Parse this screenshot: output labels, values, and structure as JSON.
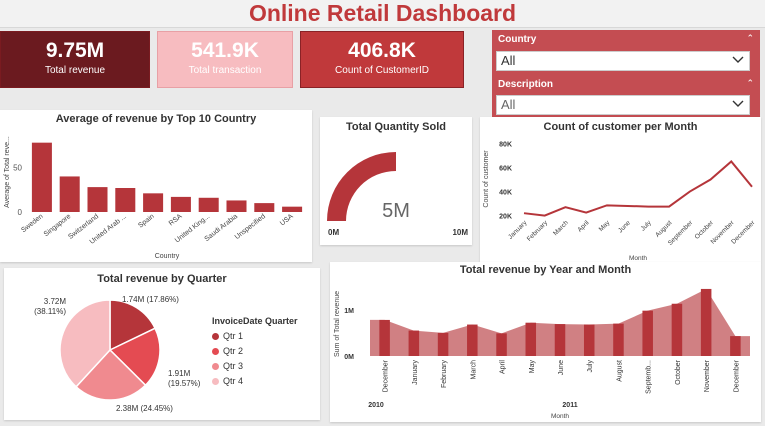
{
  "header": {
    "title": "Online Retail Dashboard"
  },
  "kpis": [
    {
      "value": "9.75M",
      "label": "Total revenue",
      "color": "#6b1a1f"
    },
    {
      "value": "541.9K",
      "label": "Total transaction",
      "color": "#f7bcc0"
    },
    {
      "value": "406.8K",
      "label": "Count of CustomerID",
      "color": "#c0393b"
    }
  ],
  "filters": {
    "country": {
      "label": "Country",
      "value": "All"
    },
    "description": {
      "label": "Description",
      "value": "All"
    }
  },
  "colors": {
    "dark": "#b5353a",
    "mid": "#c86a6d",
    "light": "#f5b8bb",
    "accent": "#c0393b"
  },
  "chart_data": [
    {
      "type": "bar",
      "title": "Average of revenue by Top 10 Country",
      "xlabel": "Country",
      "ylabel": "Average of Total reve...",
      "yticks": [
        0,
        50
      ],
      "ylim": [
        0,
        90
      ],
      "categories": [
        "Sweden",
        "Singapore",
        "Switzerland",
        "United Arab ...",
        "Spain",
        "RSA",
        "United King...",
        "Saudi Arabia",
        "Unspecified",
        "USA"
      ],
      "values": [
        78,
        40,
        28,
        27,
        21,
        17,
        16,
        13,
        10,
        6
      ]
    },
    {
      "type": "gauge",
      "title": "Total Quantity Sold",
      "value": 5,
      "value_label": "5M",
      "min": 0,
      "max": 10,
      "min_label": "0M",
      "max_label": "10M"
    },
    {
      "type": "line",
      "title": "Count of customer per Month",
      "xlabel": "Month",
      "ylabel": "Count of customer",
      "yticks": [
        "20K",
        "40K",
        "60K",
        "80K"
      ],
      "ylim": [
        18000,
        82000
      ],
      "categories": [
        "January",
        "February",
        "March",
        "April",
        "May",
        "June",
        "July",
        "August",
        "September",
        "October",
        "November",
        "December"
      ],
      "values": [
        22000,
        20000,
        27000,
        22500,
        28500,
        28000,
        27500,
        27500,
        40000,
        50000,
        65000,
        44000
      ]
    },
    {
      "type": "pie",
      "title": "Total revenue by Quarter",
      "legend_title": "InvoiceDate Quarter",
      "series": [
        {
          "name": "Qtr 1",
          "value": 1.74,
          "label": "1.74M (17.86%)",
          "color": "#b5353a"
        },
        {
          "name": "Qtr 2",
          "value": 1.91,
          "label": "1.91M (19.57%)",
          "color": "#e44b52"
        },
        {
          "name": "Qtr 3",
          "value": 2.38,
          "label": "2.38M (24.45%)",
          "color": "#f08a8f"
        },
        {
          "name": "Qtr 4",
          "value": 3.72,
          "label": "3.72M (38.11%)",
          "color": "#f7bcc0"
        }
      ]
    },
    {
      "type": "area",
      "title": "Total revenue by Year and Month",
      "xlabel": "Month",
      "ylabel": "Sum of Total revenue",
      "yticks": [
        "0M",
        "1M"
      ],
      "ylim": [
        0,
        1.6
      ],
      "categories": [
        "December",
        "January",
        "February",
        "March",
        "April",
        "May",
        "June",
        "July",
        "August",
        "Septemb...",
        "October",
        "November",
        "December"
      ],
      "years": [
        "2010",
        "2011"
      ],
      "values": [
        0.78,
        0.55,
        0.5,
        0.68,
        0.49,
        0.72,
        0.69,
        0.68,
        0.7,
        0.98,
        1.13,
        1.45,
        0.43
      ]
    }
  ]
}
